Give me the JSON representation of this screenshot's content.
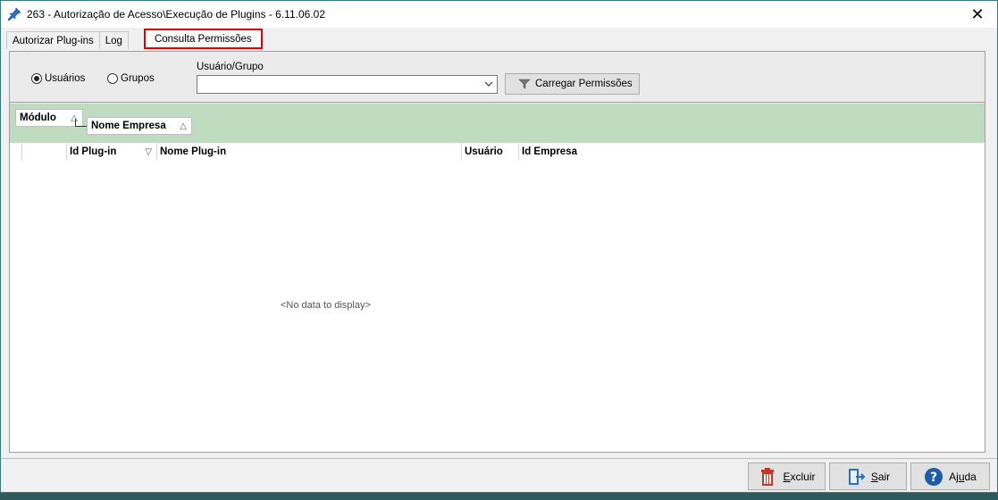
{
  "window": {
    "title": "263 - Autorização de Acesso\\Execução de Plugins - 6.11.06.02",
    "close_glyph": "✕"
  },
  "tabs": [
    {
      "label": "Autorizar Plug-ins",
      "active": false
    },
    {
      "label": "Log",
      "active": false
    },
    {
      "label": "Consulta Permissões",
      "active": true
    }
  ],
  "filter": {
    "radio_users": "Usuários",
    "radio_groups": "Grupos",
    "selected": "Usuários",
    "field_label": "Usuário/Grupo",
    "combo_value": "",
    "load_button": "Carregar Permissões"
  },
  "group_panel": {
    "chips": [
      "Módulo",
      "Nome Empresa"
    ],
    "sort_glyph": "△",
    "background": "#c0dcc0"
  },
  "grid": {
    "columns": [
      "Id Plug-in",
      "Nome Plug-in",
      "Usuário",
      "Id Empresa"
    ],
    "sort_glyph": "▽",
    "empty_text": "<No data to display>"
  },
  "buttons": {
    "delete_first": "E",
    "delete_rest": "xcluir",
    "exit_first": "S",
    "exit_rest": "air",
    "help_first": "Aj",
    "help_u": "u",
    "help_rest": "da"
  },
  "colors": {
    "active_tab_border": "#e00000",
    "group_band": "#c0dcc0",
    "help_icon": "#1e5aa8"
  }
}
